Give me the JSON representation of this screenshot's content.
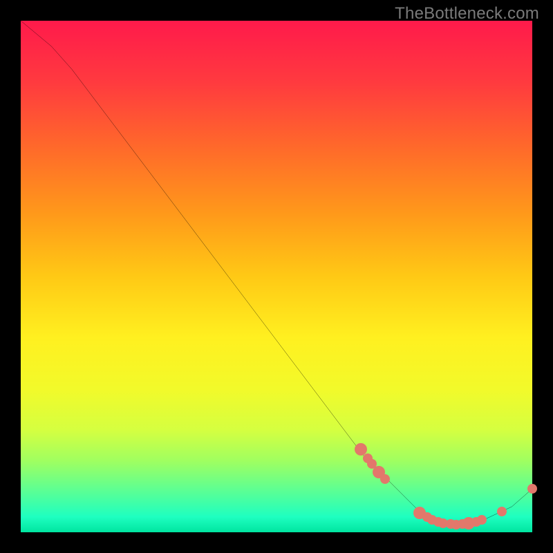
{
  "watermark": "TheBottleneck.com",
  "chart_data": {
    "type": "line",
    "title": "",
    "xlabel": "",
    "ylabel": "",
    "xlim": [
      0,
      100
    ],
    "ylim": [
      0,
      100
    ],
    "grid": false,
    "series": [
      {
        "name": "curve",
        "path": [
          {
            "x": 0,
            "y": 100
          },
          {
            "x": 6,
            "y": 95
          },
          {
            "x": 10,
            "y": 90.5
          },
          {
            "x": 67,
            "y": 15
          },
          {
            "x": 78,
            "y": 4
          },
          {
            "x": 84,
            "y": 1.5
          },
          {
            "x": 90,
            "y": 2.2
          },
          {
            "x": 96,
            "y": 5
          },
          {
            "x": 100,
            "y": 8.5
          }
        ]
      }
    ],
    "markers": [
      {
        "x": 66.5,
        "y": 16.2,
        "size": "big"
      },
      {
        "x": 67.8,
        "y": 14.5,
        "size": "small"
      },
      {
        "x": 68.6,
        "y": 13.4,
        "size": "small"
      },
      {
        "x": 70.0,
        "y": 11.8,
        "size": "big"
      },
      {
        "x": 71.2,
        "y": 10.4,
        "size": "small"
      },
      {
        "x": 78.0,
        "y": 3.8,
        "size": "big"
      },
      {
        "x": 79.4,
        "y": 3.0,
        "size": "small"
      },
      {
        "x": 80.4,
        "y": 2.5,
        "size": "small"
      },
      {
        "x": 81.6,
        "y": 2.0,
        "size": "small"
      },
      {
        "x": 82.6,
        "y": 1.8,
        "size": "small"
      },
      {
        "x": 84.0,
        "y": 1.6,
        "size": "small"
      },
      {
        "x": 85.2,
        "y": 1.5,
        "size": "small"
      },
      {
        "x": 86.4,
        "y": 1.6,
        "size": "small"
      },
      {
        "x": 87.6,
        "y": 1.8,
        "size": "big"
      },
      {
        "x": 89.0,
        "y": 2.0,
        "size": "small"
      },
      {
        "x": 90.2,
        "y": 2.4,
        "size": "small"
      },
      {
        "x": 94.0,
        "y": 4.0,
        "size": "small"
      },
      {
        "x": 100.0,
        "y": 8.5,
        "size": "small"
      }
    ],
    "colors": {
      "curve": "#000000",
      "marker": "#e2786b"
    }
  }
}
